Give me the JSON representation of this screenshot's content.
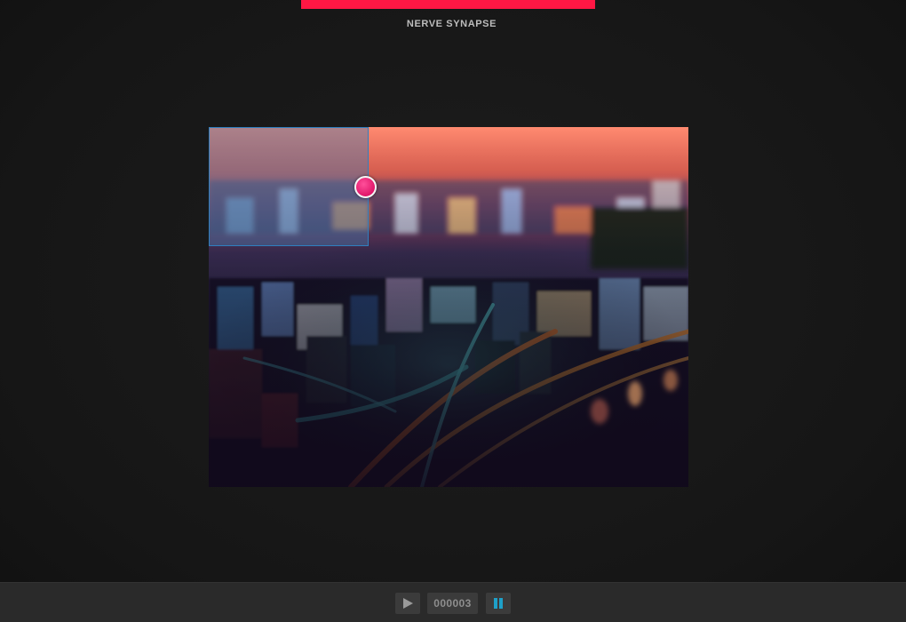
{
  "header": {
    "title": "NERVE SYNAPSE",
    "accent_color": "#ff1744"
  },
  "viewer": {
    "image_alt": "tilt-shift city night skyline with highway light trails",
    "selection_color": "#2f7fbf",
    "handle_color": "#e0176a"
  },
  "controls": {
    "play_icon": "play-icon",
    "counter": "000003",
    "pause_icon": "pause-icon",
    "pause_color": "#1ea0c8"
  }
}
